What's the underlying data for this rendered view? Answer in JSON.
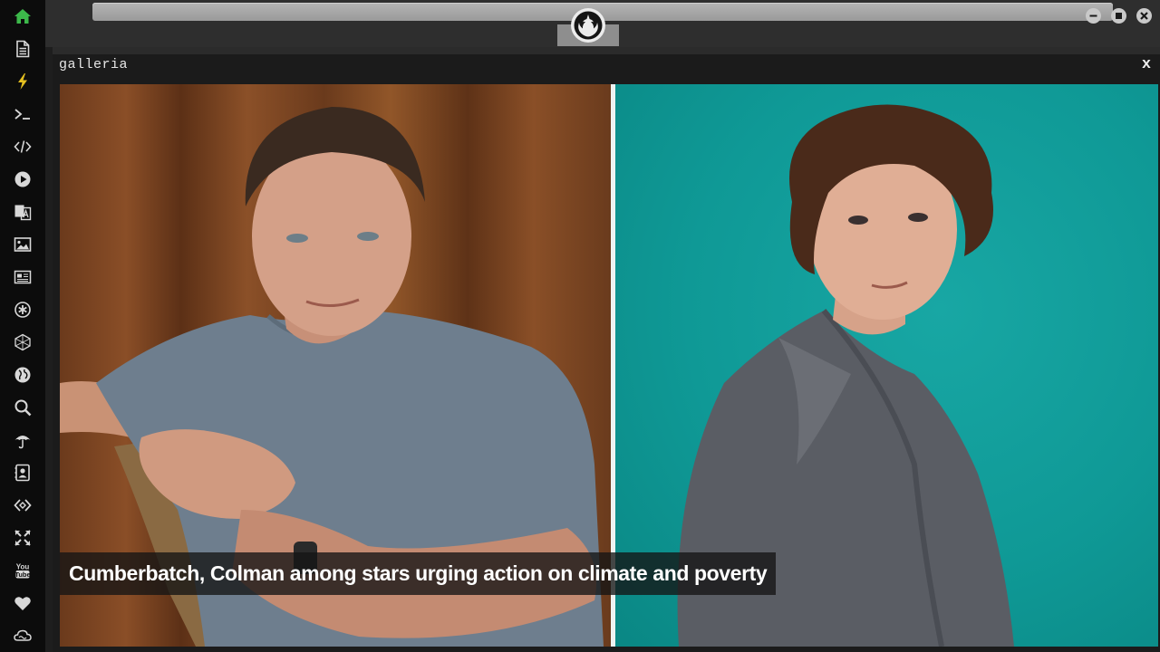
{
  "window": {
    "title": "galleria",
    "close_label": "x"
  },
  "gallery": {
    "caption": "Cumberbatch, Colman among stars urging action on climate and poverty",
    "left_photo": "portrait of man in grey t-shirt seated on chair in front of brown curtain",
    "right_photo": "portrait of woman in grey jacket in front of teal background"
  },
  "dock": {
    "items": [
      "home-icon",
      "document-icon",
      "bolt-icon",
      "terminal-icon",
      "code-icon",
      "play-icon",
      "translate-icon",
      "image-icon",
      "news-icon",
      "settings-icon",
      "cube-icon",
      "globe-icon",
      "search-icon",
      "umbrella-icon",
      "contacts-icon",
      "connect-icon",
      "expand-icon",
      "youtube-icon",
      "heart-icon",
      "cloud-icon"
    ]
  },
  "colors": {
    "dock_bg": "#0c0c0c",
    "home_active": "#3cb84a",
    "bolt": "#e5c020",
    "teal_bg": "#0f9996"
  }
}
